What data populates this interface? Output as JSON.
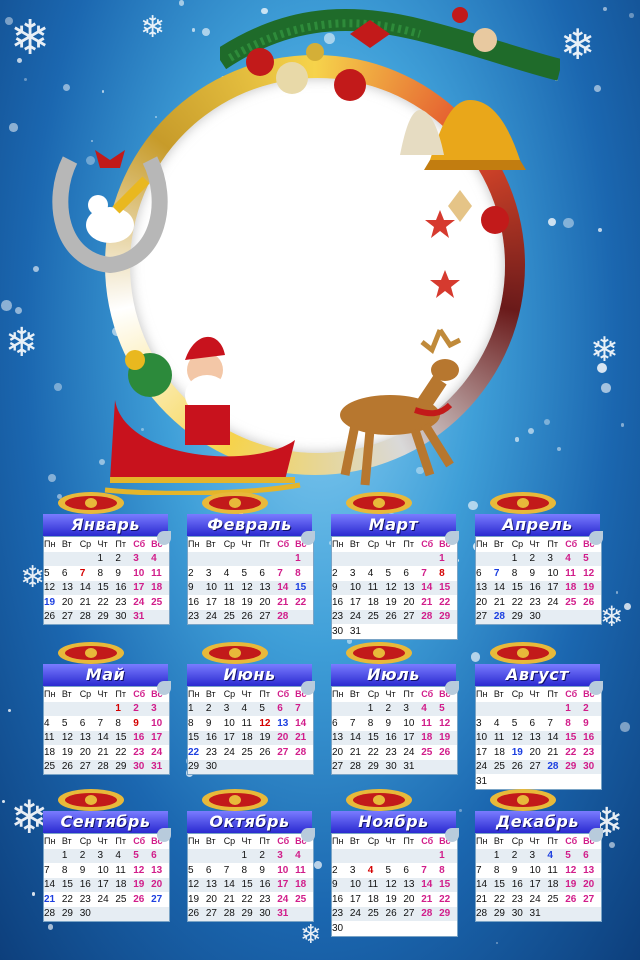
{
  "calendar": {
    "weekday_headers": [
      "Пн",
      "Вт",
      "Ср",
      "Чт",
      "Пт",
      "Сб",
      "Вс"
    ],
    "months": [
      {
        "name": "Январь",
        "rows": [
          [
            "",
            "",
            "",
            "1",
            "2",
            "3",
            "4"
          ],
          [
            "5",
            "6",
            "7",
            "8",
            "9",
            "10",
            "11"
          ],
          [
            "12",
            "13",
            "14",
            "15",
            "16",
            "17",
            "18"
          ],
          [
            "19",
            "20",
            "21",
            "22",
            "23",
            "24",
            "25"
          ],
          [
            "26",
            "27",
            "28",
            "29",
            "30",
            "31",
            ""
          ]
        ]
      },
      {
        "name": "Февраль",
        "rows": [
          [
            "",
            "",
            "",
            "",
            "",
            "",
            "1"
          ],
          [
            "2",
            "3",
            "4",
            "5",
            "6",
            "7",
            "8"
          ],
          [
            "9",
            "10",
            "11",
            "12",
            "13",
            "14",
            "15"
          ],
          [
            "16",
            "17",
            "18",
            "19",
            "20",
            "21",
            "22"
          ],
          [
            "23",
            "24",
            "25",
            "26",
            "27",
            "28",
            ""
          ]
        ]
      },
      {
        "name": "Март",
        "rows": [
          [
            "",
            "",
            "",
            "",
            "",
            "",
            "1"
          ],
          [
            "2",
            "3",
            "4",
            "5",
            "6",
            "7",
            "8"
          ],
          [
            "9",
            "10",
            "11",
            "12",
            "13",
            "14",
            "15"
          ],
          [
            "16",
            "17",
            "18",
            "19",
            "20",
            "21",
            "22"
          ],
          [
            "23",
            "24",
            "25",
            "26",
            "27",
            "28",
            "29"
          ],
          [
            "30",
            "31",
            "",
            "",
            "",
            "",
            ""
          ]
        ]
      },
      {
        "name": "Апрель",
        "rows": [
          [
            "",
            "",
            "1",
            "2",
            "3",
            "4",
            "5"
          ],
          [
            "6",
            "7",
            "8",
            "9",
            "10",
            "11",
            "12"
          ],
          [
            "13",
            "14",
            "15",
            "16",
            "17",
            "18",
            "19"
          ],
          [
            "20",
            "21",
            "22",
            "23",
            "24",
            "25",
            "26"
          ],
          [
            "27",
            "28",
            "29",
            "30",
            "",
            "",
            ""
          ]
        ]
      },
      {
        "name": "Май",
        "rows": [
          [
            "",
            "",
            "",
            "",
            "1",
            "2",
            "3"
          ],
          [
            "4",
            "5",
            "6",
            "7",
            "8",
            "9",
            "10"
          ],
          [
            "11",
            "12",
            "13",
            "14",
            "15",
            "16",
            "17"
          ],
          [
            "18",
            "19",
            "20",
            "21",
            "22",
            "23",
            "24"
          ],
          [
            "25",
            "26",
            "27",
            "28",
            "29",
            "30",
            "31"
          ]
        ]
      },
      {
        "name": "Июнь",
        "rows": [
          [
            "1",
            "2",
            "3",
            "4",
            "5",
            "6",
            "7"
          ],
          [
            "8",
            "9",
            "10",
            "11",
            "12",
            "13",
            "14"
          ],
          [
            "15",
            "16",
            "17",
            "18",
            "19",
            "20",
            "21"
          ],
          [
            "22",
            "23",
            "24",
            "25",
            "26",
            "27",
            "28"
          ],
          [
            "29",
            "30",
            "",
            "",
            "",
            "",
            ""
          ]
        ]
      },
      {
        "name": "Июль",
        "rows": [
          [
            "",
            "",
            "1",
            "2",
            "3",
            "4",
            "5"
          ],
          [
            "6",
            "7",
            "8",
            "9",
            "10",
            "11",
            "12"
          ],
          [
            "13",
            "14",
            "15",
            "16",
            "17",
            "18",
            "19"
          ],
          [
            "20",
            "21",
            "22",
            "23",
            "24",
            "25",
            "26"
          ],
          [
            "27",
            "28",
            "29",
            "30",
            "31",
            "",
            ""
          ]
        ]
      },
      {
        "name": "Август",
        "rows": [
          [
            "",
            "",
            "",
            "",
            "",
            "1",
            "2"
          ],
          [
            "3",
            "4",
            "5",
            "6",
            "7",
            "8",
            "9"
          ],
          [
            "10",
            "11",
            "12",
            "13",
            "14",
            "15",
            "16"
          ],
          [
            "17",
            "18",
            "19",
            "20",
            "21",
            "22",
            "23"
          ],
          [
            "24",
            "25",
            "26",
            "27",
            "28",
            "29",
            "30"
          ],
          [
            "31",
            "",
            "",
            "",
            "",
            "",
            ""
          ]
        ]
      },
      {
        "name": "Сентябрь",
        "rows": [
          [
            "",
            "1",
            "2",
            "3",
            "4",
            "5",
            "6"
          ],
          [
            "7",
            "8",
            "9",
            "10",
            "11",
            "12",
            "13"
          ],
          [
            "14",
            "15",
            "16",
            "17",
            "18",
            "19",
            "20"
          ],
          [
            "21",
            "22",
            "23",
            "24",
            "25",
            "26",
            "27"
          ],
          [
            "28",
            "29",
            "30",
            "",
            "",
            "",
            ""
          ]
        ]
      },
      {
        "name": "Октябрь",
        "rows": [
          [
            "",
            "",
            "",
            "1",
            "2",
            "3",
            "4"
          ],
          [
            "5",
            "6",
            "7",
            "8",
            "9",
            "10",
            "11"
          ],
          [
            "12",
            "13",
            "14",
            "15",
            "16",
            "17",
            "18"
          ],
          [
            "19",
            "20",
            "21",
            "22",
            "23",
            "24",
            "25"
          ],
          [
            "26",
            "27",
            "28",
            "29",
            "30",
            "31",
            ""
          ]
        ]
      },
      {
        "name": "Ноябрь",
        "rows": [
          [
            "",
            "",
            "",
            "",
            "",
            "",
            "1"
          ],
          [
            "2",
            "3",
            "4",
            "5",
            "6",
            "7",
            "8"
          ],
          [
            "9",
            "10",
            "11",
            "12",
            "13",
            "14",
            "15"
          ],
          [
            "16",
            "17",
            "18",
            "19",
            "20",
            "21",
            "22"
          ],
          [
            "23",
            "24",
            "25",
            "26",
            "27",
            "28",
            "29"
          ],
          [
            "30",
            "",
            "",
            "",
            "",
            "",
            ""
          ]
        ]
      },
      {
        "name": "Декабрь",
        "rows": [
          [
            "",
            "1",
            "2",
            "3",
            "4",
            "5",
            "6"
          ],
          [
            "7",
            "8",
            "9",
            "10",
            "11",
            "12",
            "13"
          ],
          [
            "14",
            "15",
            "16",
            "17",
            "18",
            "19",
            "20"
          ],
          [
            "21",
            "22",
            "23",
            "24",
            "25",
            "26",
            "27"
          ],
          [
            "28",
            "29",
            "30",
            "31",
            "",
            "",
            ""
          ]
        ]
      }
    ],
    "holidays_red": [
      "Январь:7",
      "Март:8",
      "Май:1",
      "Май:9",
      "Июнь:12",
      "Ноябрь:4"
    ],
    "holidays_blue": [
      "Январь:19",
      "Февраль:15",
      "Апрель:7",
      "Апрель:28",
      "Июнь:13",
      "Июнь:22",
      "Август:19",
      "Август:28",
      "Сентябрь:21",
      "Сентябрь:27",
      "Декабрь:4"
    ],
    "colors": {
      "weekend": "#d11d8a",
      "holiday_red": "#d40000",
      "holiday_blue": "#1c3fe0",
      "title_bar": "#2a2ad0"
    }
  },
  "decor": {
    "icons": [
      "christmas-ornament-garland-icon",
      "horseshoe-with-unicorn-icon",
      "santa-sleigh-icon",
      "reindeer-icon",
      "bells-icon",
      "snowflake-icon",
      "star-icon"
    ]
  }
}
